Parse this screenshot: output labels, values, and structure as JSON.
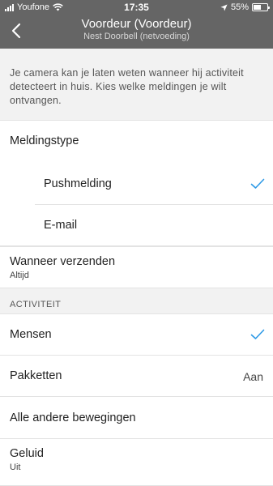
{
  "status_bar": {
    "carrier": "Youfone",
    "time": "17:35",
    "battery": "55%",
    "battery_level": 0.55
  },
  "header": {
    "title": "Voordeur (Voordeur)",
    "subtitle": "Nest Doorbell (netvoeding)"
  },
  "intro_text": "Je camera kan je laten weten wanneer hij activiteit detecteert in huis. Kies welke meldingen je wilt ontvangen.",
  "notification_type": {
    "label": "Meldingstype",
    "options": [
      {
        "label": "Pushmelding",
        "checked": true
      },
      {
        "label": "E-mail",
        "checked": false
      }
    ]
  },
  "send_when": {
    "label": "Wanneer verzenden",
    "value": "Altijd"
  },
  "activity": {
    "header": "ACTIVITEIT",
    "items": [
      {
        "label": "Mensen",
        "checked": true,
        "value": ""
      },
      {
        "label": "Pakketten",
        "checked": false,
        "value": "Aan"
      },
      {
        "label": "Alle andere bewegingen",
        "checked": false,
        "value": ""
      }
    ]
  },
  "sound": {
    "label": "Geluid",
    "value": "Uit"
  },
  "colors": {
    "header_bg": "#656565",
    "accent": "#2e9ae6",
    "page_bg": "#f2f2f2"
  },
  "icons": {
    "back": "chevron-left-icon",
    "check": "checkmark-icon",
    "wifi": "wifi-icon",
    "location": "location-arrow-icon",
    "battery": "battery-icon"
  }
}
